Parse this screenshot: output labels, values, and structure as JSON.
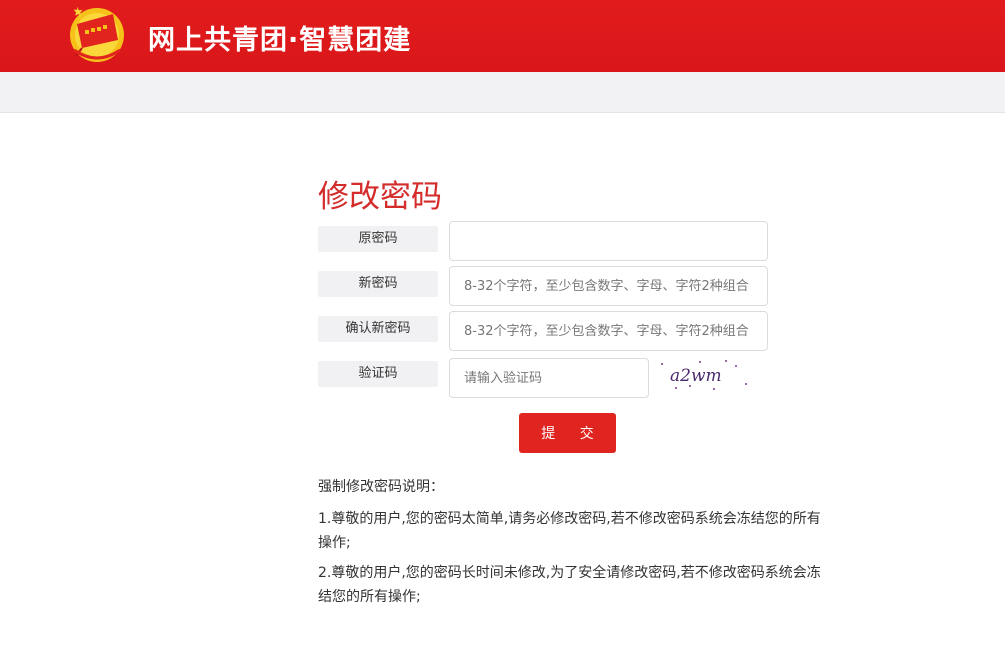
{
  "header": {
    "logo_icon": "communist-youth-league-emblem-icon",
    "title": "网上共青团·智慧团建"
  },
  "form": {
    "title": "修改密码",
    "old_password": {
      "label": "原密码",
      "placeholder": "",
      "value": ""
    },
    "new_password": {
      "label": "新密码",
      "placeholder": "8-32个字符，至少包含数字、字母、字符2种组合"
    },
    "confirm_password": {
      "label": "确认新密码",
      "placeholder": "8-32个字符，至少包含数字、字母、字符2种组合"
    },
    "captcha": {
      "label": "验证码",
      "placeholder": "请输入验证码",
      "image_text": "a2wm"
    },
    "submit_label": "提 交"
  },
  "notes": {
    "heading": "强制修改密码说明：",
    "items": [
      "1.尊敬的用户,您的密码太简单,请务必修改密码,若不修改密码系统会冻结您的所有操作;",
      "2.尊敬的用户,您的密码长时间未修改,为了安全请修改密码,若不修改密码系统会冻结您的所有操作;"
    ]
  },
  "colors": {
    "brand_red": "#e0241f",
    "title_red": "#d42b2b",
    "label_bg": "#f1f1f3"
  }
}
